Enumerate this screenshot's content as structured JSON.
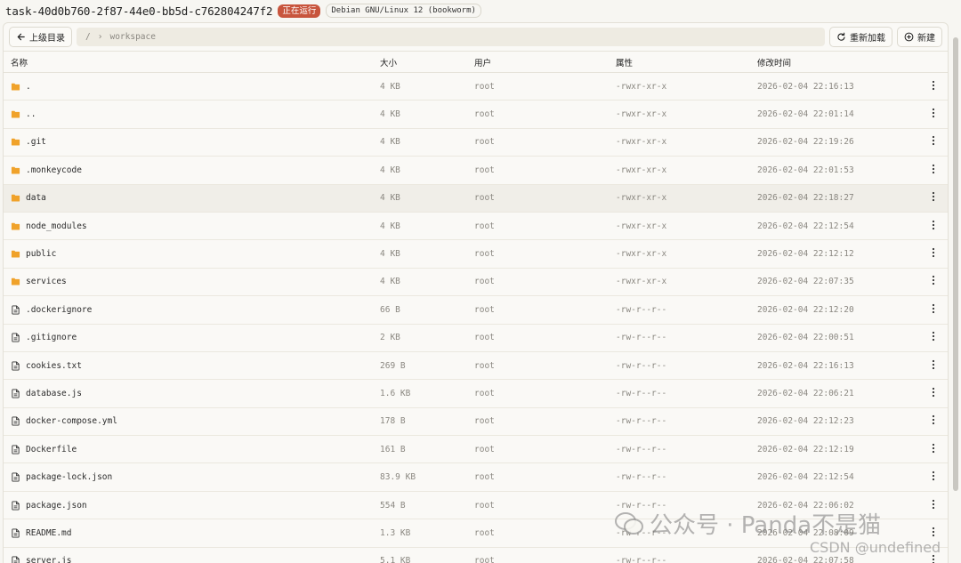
{
  "header": {
    "task_id": "task-40d0b760-2f87-44e0-bb5d-c762804247f2",
    "status": "正在运行",
    "os": "Debian GNU/Linux 12 (bookworm)"
  },
  "toolbar": {
    "up_label": "上级目录",
    "path_root": "/",
    "path_sep": "›",
    "path_current": "workspace",
    "reload_label": "重新加载",
    "new_label": "新建"
  },
  "columns": {
    "name": "名称",
    "size": "大小",
    "user": "用户",
    "perm": "属性",
    "mtime": "修改时间"
  },
  "files": [
    {
      "icon": "folder-icon",
      "name": ".",
      "size": "4 KB",
      "user": "root",
      "perm": "-rwxr-xr-x",
      "mtime": "2026-02-04 22:16:13"
    },
    {
      "icon": "folder-icon",
      "name": "..",
      "size": "4 KB",
      "user": "root",
      "perm": "-rwxr-xr-x",
      "mtime": "2026-02-04 22:01:14"
    },
    {
      "icon": "folder-icon",
      "name": ".git",
      "size": "4 KB",
      "user": "root",
      "perm": "-rwxr-xr-x",
      "mtime": "2026-02-04 22:19:26"
    },
    {
      "icon": "folder-icon",
      "name": ".monkeycode",
      "size": "4 KB",
      "user": "root",
      "perm": "-rwxr-xr-x",
      "mtime": "2026-02-04 22:01:53"
    },
    {
      "icon": "folder-icon",
      "name": "data",
      "size": "4 KB",
      "user": "root",
      "perm": "-rwxr-xr-x",
      "mtime": "2026-02-04 22:18:27"
    },
    {
      "icon": "folder-icon",
      "name": "node_modules",
      "size": "4 KB",
      "user": "root",
      "perm": "-rwxr-xr-x",
      "mtime": "2026-02-04 22:12:54"
    },
    {
      "icon": "folder-icon",
      "name": "public",
      "size": "4 KB",
      "user": "root",
      "perm": "-rwxr-xr-x",
      "mtime": "2026-02-04 22:12:12"
    },
    {
      "icon": "folder-icon",
      "name": "services",
      "size": "4 KB",
      "user": "root",
      "perm": "-rwxr-xr-x",
      "mtime": "2026-02-04 22:07:35"
    },
    {
      "icon": "file-icon",
      "name": ".dockerignore",
      "size": "66 B",
      "user": "root",
      "perm": "-rw-r--r--",
      "mtime": "2026-02-04 22:12:20"
    },
    {
      "icon": "file-icon",
      "name": ".gitignore",
      "size": "2 KB",
      "user": "root",
      "perm": "-rw-r--r--",
      "mtime": "2026-02-04 22:00:51"
    },
    {
      "icon": "file-icon",
      "name": "cookies.txt",
      "size": "269 B",
      "user": "root",
      "perm": "-rw-r--r--",
      "mtime": "2026-02-04 22:16:13"
    },
    {
      "icon": "file-icon",
      "name": "database.js",
      "size": "1.6 KB",
      "user": "root",
      "perm": "-rw-r--r--",
      "mtime": "2026-02-04 22:06:21"
    },
    {
      "icon": "file-icon",
      "name": "docker-compose.yml",
      "size": "178 B",
      "user": "root",
      "perm": "-rw-r--r--",
      "mtime": "2026-02-04 22:12:23"
    },
    {
      "icon": "file-icon",
      "name": "Dockerfile",
      "size": "161 B",
      "user": "root",
      "perm": "-rw-r--r--",
      "mtime": "2026-02-04 22:12:19"
    },
    {
      "icon": "file-icon",
      "name": "package-lock.json",
      "size": "83.9 KB",
      "user": "root",
      "perm": "-rw-r--r--",
      "mtime": "2026-02-04 22:12:54"
    },
    {
      "icon": "file-icon",
      "name": "package.json",
      "size": "554 B",
      "user": "root",
      "perm": "-rw-r--r--",
      "mtime": "2026-02-04 22:06:02"
    },
    {
      "icon": "file-icon",
      "name": "README.md",
      "size": "1.3 KB",
      "user": "root",
      "perm": "-rw-r--r--",
      "mtime": "2026-02-04 22:08:09"
    },
    {
      "icon": "file-icon",
      "name": "server.js",
      "size": "5.1 KB",
      "user": "root",
      "perm": "-rw-r--r--",
      "mtime": "2026-02-04 22:07:58"
    }
  ],
  "hover_index": 4,
  "watermark": {
    "wechat": "公众号 · Panda不是猫",
    "csdn": "CSDN @undefined"
  },
  "colors": {
    "folder": "#f0a22a",
    "status_badge": "#c8553d"
  }
}
